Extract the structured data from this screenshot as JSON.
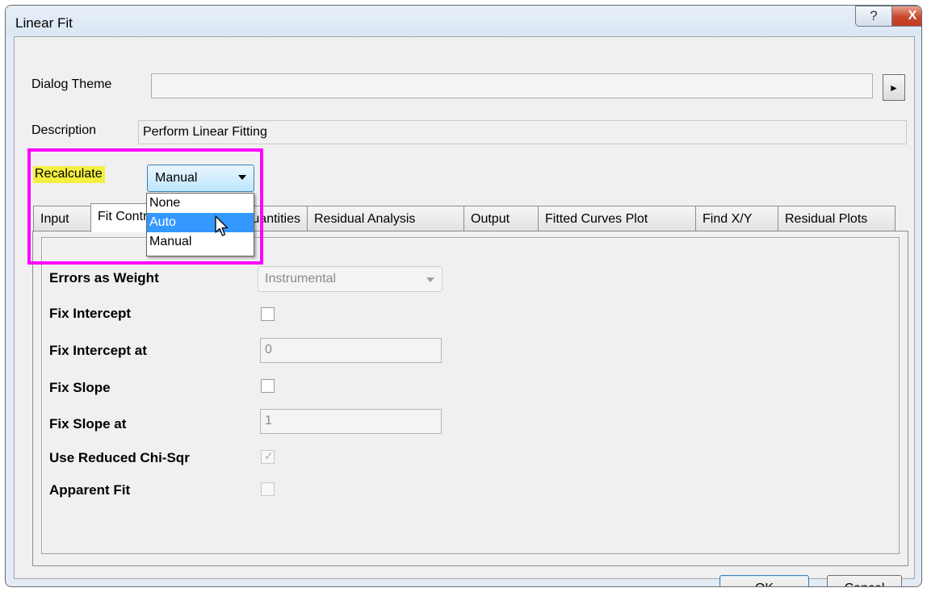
{
  "window": {
    "title": "Linear Fit",
    "help_glyph": "?",
    "close_glyph": "X"
  },
  "dialog_theme": {
    "label": "Dialog Theme",
    "value": "",
    "arrow_glyph": "►"
  },
  "description": {
    "label": "Description",
    "value": "Perform Linear Fitting"
  },
  "recalculate": {
    "label": "Recalculate",
    "selected": "Manual",
    "options": [
      "None",
      "Auto",
      "Manual"
    ],
    "highlighted_option": "Auto"
  },
  "tabs": [
    {
      "label": "Input",
      "active": false
    },
    {
      "label": "Fit Control",
      "active": true
    },
    {
      "label": "Quantities",
      "active": false
    },
    {
      "label": "Residual Analysis",
      "active": false
    },
    {
      "label": "Output",
      "active": false
    },
    {
      "label": "Fitted Curves Plot",
      "active": false
    },
    {
      "label": "Find X/Y",
      "active": false
    },
    {
      "label": "Residual Plots",
      "active": false
    }
  ],
  "fit_control": {
    "errors_as_weight": {
      "label": "Errors as Weight",
      "value": "Instrumental"
    },
    "fix_intercept": {
      "label": "Fix Intercept",
      "checked": false
    },
    "fix_intercept_at": {
      "label": "Fix Intercept at",
      "value": "0"
    },
    "fix_slope": {
      "label": "Fix Slope",
      "checked": false
    },
    "fix_slope_at": {
      "label": "Fix Slope at",
      "value": "1"
    },
    "use_reduced_chi_sqr": {
      "label": "Use Reduced Chi-Sqr",
      "checked": true,
      "check_glyph": "✓"
    },
    "apparent_fit": {
      "label": "Apparent Fit",
      "checked": false
    }
  },
  "buttons": {
    "ok": "OK",
    "cancel": "Cancel"
  },
  "colors": {
    "highlight_border": "#ff00ff",
    "label_highlight": "#f5ef40",
    "dropdown_selection": "#3399ff",
    "close_button": "#c8472e"
  }
}
